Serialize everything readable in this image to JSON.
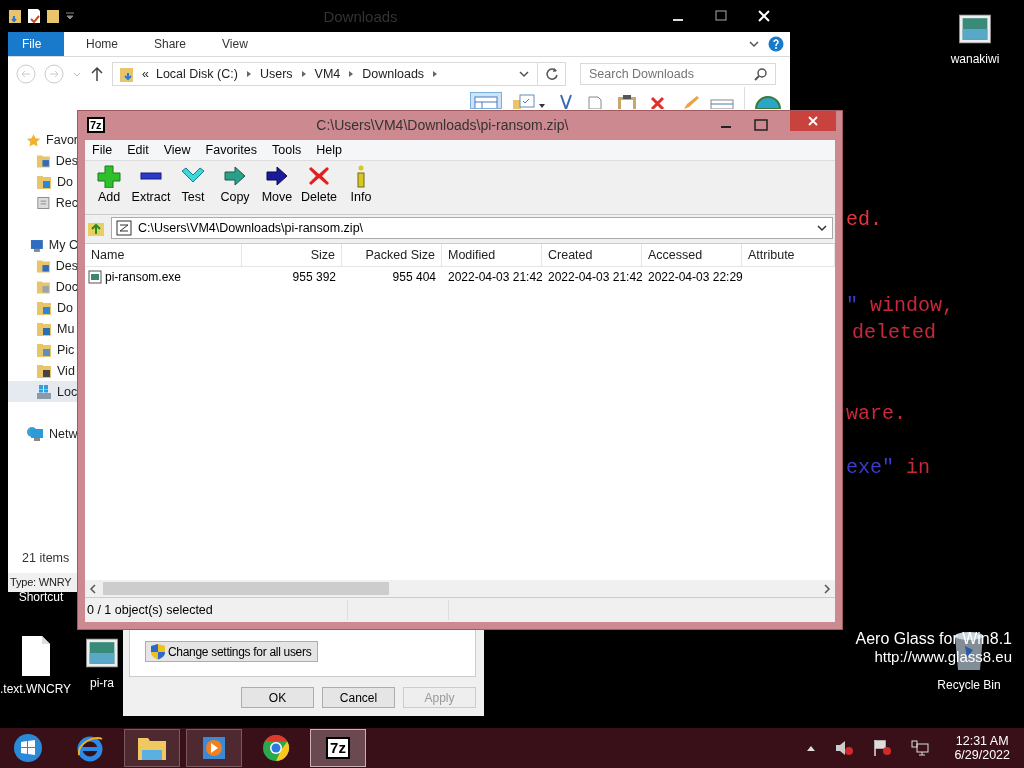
{
  "desktop": {
    "console_lines": [
      {
        "segments": [
          {
            "text": "ed.",
            "color": "#e8323c"
          }
        ]
      },
      {
        "segments": [
          {
            "text": "\"",
            "color": "#3c3cc8"
          },
          {
            "text": " window,",
            "color": "#c8283a"
          }
        ]
      },
      {
        "segments": [
          {
            "text": "deleted",
            "color": "#c8283a"
          }
        ]
      },
      {
        "segments": [
          {
            "text": "ware.",
            "color": "#c8283a"
          }
        ]
      },
      {
        "segments": [
          {
            "text": "exe\"",
            "color": "#3c3cc8"
          },
          {
            "text": " in",
            "color": "#c8283a"
          }
        ]
      }
    ],
    "icons": [
      {
        "label": "wanakiwi",
        "kind": "app"
      },
      {
        "label": "Shortcut",
        "kind": "caption"
      },
      {
        "label": ".text.WNCRY",
        "kind": "file"
      },
      {
        "label": "pi-ra",
        "kind": "app"
      },
      {
        "label": "Recycle Bin",
        "kind": "bin"
      }
    ],
    "watermark": [
      "Aero Glass for Win8.1",
      "http://www.glass8.eu"
    ]
  },
  "explorer": {
    "title": "Downloads",
    "ribbon_tabs": [
      {
        "label": "File",
        "kind": "file"
      },
      {
        "label": "Home",
        "kind": "tab"
      },
      {
        "label": "Share",
        "kind": "tab"
      },
      {
        "label": "View",
        "kind": "tab"
      }
    ],
    "overflow": "«",
    "breadcrumbs": [
      "Local Disk (C:)",
      "Users",
      "VM4",
      "Downloads"
    ],
    "search": {
      "placeholder": "Search Downloads"
    },
    "nav": [
      {
        "label": "Favor",
        "kind": "star",
        "selected": false,
        "children": [
          {
            "label": "Des",
            "kind": "desktop",
            "selected": false
          },
          {
            "label": "Do",
            "kind": "download",
            "selected": false
          },
          {
            "label": "Rec",
            "kind": "recent",
            "selected": false
          }
        ]
      },
      {
        "label": "My C",
        "kind": "computer",
        "selected": false,
        "children": [
          {
            "label": "Des",
            "kind": "desktop",
            "selected": false
          },
          {
            "label": "Doc",
            "kind": "documents",
            "selected": false
          },
          {
            "label": "Do",
            "kind": "download",
            "selected": false
          },
          {
            "label": "Mu",
            "kind": "music",
            "selected": false
          },
          {
            "label": "Pic",
            "kind": "pictures",
            "selected": false
          },
          {
            "label": "Vid",
            "kind": "video",
            "selected": false
          },
          {
            "label": "Loc",
            "kind": "drive",
            "selected": true
          }
        ]
      },
      {
        "label": "Netw",
        "kind": "network",
        "selected": false
      }
    ],
    "item_count": "21 items",
    "status": "Type: WNRY"
  },
  "archive_window": {
    "logo": "7z",
    "title": "C:\\Users\\VM4\\Downloads\\pi-ransom.zip\\",
    "menu": [
      "File",
      "Edit",
      "View",
      "Favorites",
      "Tools",
      "Help"
    ],
    "toolbar": [
      {
        "label": "Add",
        "kind": "add"
      },
      {
        "label": "Extract",
        "kind": "extract"
      },
      {
        "label": "Test",
        "kind": "test"
      },
      {
        "label": "Copy",
        "kind": "copy"
      },
      {
        "label": "Move",
        "kind": "move"
      },
      {
        "label": "Delete",
        "kind": "delete"
      },
      {
        "label": "Info",
        "kind": "info"
      }
    ],
    "path": "C:\\Users\\VM4\\Downloads\\pi-ransom.zip\\",
    "columns": [
      "Name",
      "Size",
      "Packed Size",
      "Modified",
      "Created",
      "Accessed",
      "Attribute"
    ],
    "rows": [
      {
        "selected": false,
        "cells": [
          "pi-ransom.exe",
          "955 392",
          "955 404",
          "2022-04-03 21:42",
          "2022-04-03 21:42",
          "2022-04-03 22:29"
        ]
      }
    ],
    "status": "0 / 1 object(s) selected"
  },
  "dialog": {
    "settings_button": "Change settings for all users",
    "buttons": [
      {
        "label": "OK",
        "disabled": false
      },
      {
        "label": "Cancel",
        "disabled": false
      },
      {
        "label": "Apply",
        "disabled": true
      }
    ]
  },
  "taskbar": {
    "apps": [
      {
        "kind": "start",
        "open": false,
        "selected": false
      },
      {
        "kind": "browser-e",
        "open": false,
        "selected": false
      },
      {
        "kind": "folder",
        "open": true,
        "selected": false
      },
      {
        "kind": "player",
        "open": true,
        "selected": false
      },
      {
        "kind": "browser-c",
        "open": false,
        "selected": false
      },
      {
        "kind": "archiver",
        "open": true,
        "selected": true,
        "label": "7z"
      }
    ],
    "time": "12:31 AM",
    "date": "6/29/2022"
  }
}
